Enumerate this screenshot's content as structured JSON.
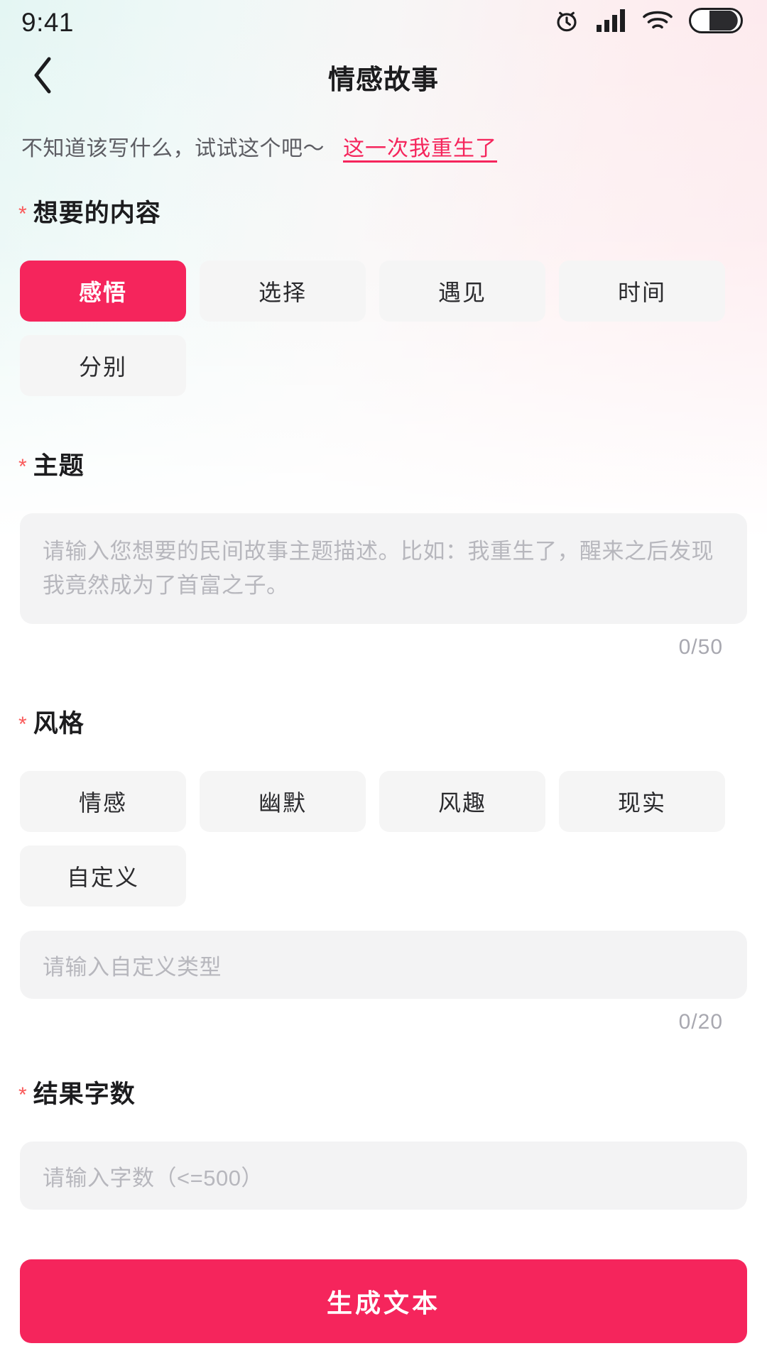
{
  "status_bar": {
    "time": "9:41",
    "icons": [
      "alarm-clock-icon",
      "cellular-signal-icon",
      "wifi-icon",
      "battery-icon"
    ]
  },
  "nav": {
    "back_icon": "chevron-left-icon",
    "title": "情感故事"
  },
  "hint": {
    "text": "不知道该写什么，试试这个吧～",
    "link": "这一次我重生了"
  },
  "sections": {
    "content": {
      "required_mark": "*",
      "label": "想要的内容",
      "chips": [
        {
          "label": "感悟",
          "selected": true
        },
        {
          "label": "选择",
          "selected": false
        },
        {
          "label": "遇见",
          "selected": false
        },
        {
          "label": "时间",
          "selected": false
        },
        {
          "label": "分别",
          "selected": false
        }
      ]
    },
    "theme": {
      "required_mark": "*",
      "label": "主题",
      "placeholder": "请输入您想要的民间故事主题描述。比如：我重生了，醒来之后发现我竟然成为了首富之子。",
      "value": "",
      "counter": "0/50"
    },
    "style": {
      "required_mark": "*",
      "label": "风格",
      "chips": [
        {
          "label": "情感",
          "selected": false
        },
        {
          "label": "幽默",
          "selected": false
        },
        {
          "label": "风趣",
          "selected": false
        },
        {
          "label": "现实",
          "selected": false
        },
        {
          "label": "自定义",
          "selected": false
        }
      ],
      "custom_placeholder": "请输入自定义类型",
      "custom_value": "",
      "counter": "0/20"
    },
    "word_count": {
      "required_mark": "*",
      "label": "结果字数",
      "placeholder": "请输入字数（<=500）",
      "value": ""
    }
  },
  "submit": {
    "label": "生成文本"
  },
  "colors": {
    "accent": "#f5255c",
    "required_star": "#fa5a5a",
    "chip_bg": "#f5f5f5",
    "field_bg": "#f3f3f4",
    "placeholder": "#b7b7bd",
    "title": "#1c1c1e",
    "gradient_left": "#e4f6f3",
    "gradient_right": "#fde8ec"
  }
}
